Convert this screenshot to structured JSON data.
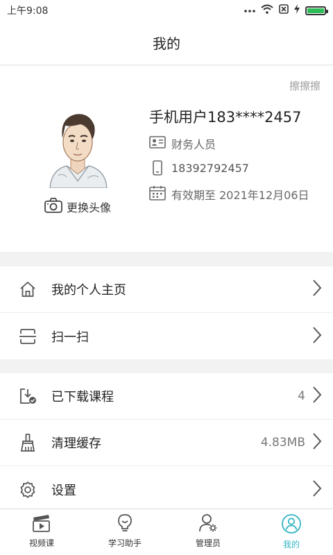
{
  "status": {
    "time": "上午9:08",
    "battery_level": 1.0,
    "battery_color": "#2ebd59"
  },
  "header": {
    "title": "我的"
  },
  "profile": {
    "wipe_label": "擦擦擦",
    "name": "手机用户183****2457",
    "role": "财务人员",
    "phone": "18392792457",
    "validity": "有效期至 2021年12月06日",
    "change_avatar_label": "更换头像"
  },
  "menu_group1": [
    {
      "label": "我的个人主页",
      "icon": "home-icon"
    },
    {
      "label": "扫一扫",
      "icon": "scan-icon"
    }
  ],
  "menu_group2": [
    {
      "label": "已下载课程",
      "value": "4",
      "icon": "download-icon"
    },
    {
      "label": "清理缓存",
      "value": "4.83MB",
      "icon": "brush-icon"
    },
    {
      "label": "设置",
      "value": "",
      "icon": "gear-icon"
    }
  ],
  "tabs": [
    {
      "label": "视频课",
      "icon": "clapperboard-icon"
    },
    {
      "label": "学习助手",
      "icon": "lightbulb-icon"
    },
    {
      "label": "管理员",
      "icon": "admin-icon"
    },
    {
      "label": "我的",
      "icon": "user-icon",
      "active": true
    }
  ],
  "colors": {
    "accent": "#33b5c4"
  }
}
